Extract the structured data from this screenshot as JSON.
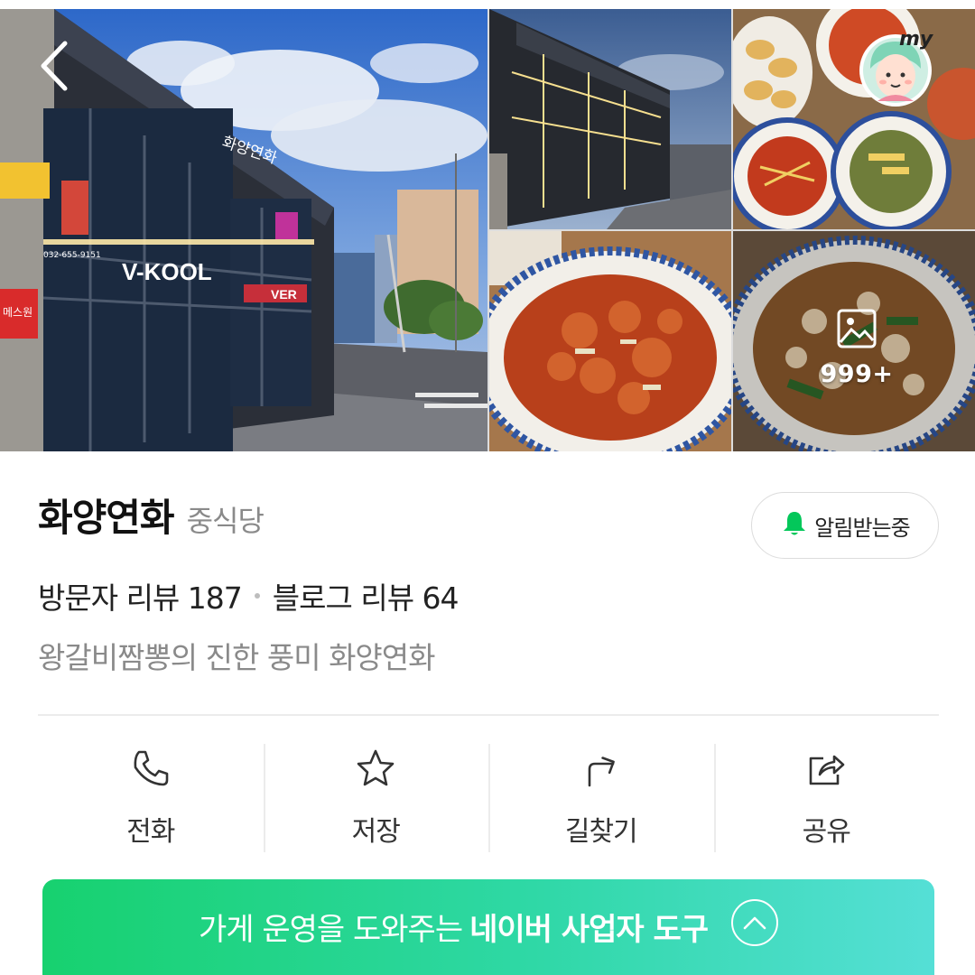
{
  "gallery": {
    "photo_count": "999+",
    "storefront_signs": {
      "main": "V-KOOL",
      "restaurant": "화양연화",
      "phone": "032-655-9151",
      "left_store": "메스원",
      "right_store": "VER"
    }
  },
  "place": {
    "name": "화양연화",
    "category": "중식당",
    "notify_label": "알림받는중",
    "visitor_review": "방문자 리뷰 187",
    "blog_review": "블로그 리뷰 64",
    "description": "왕갈비짬뽕의 진한 풍미 화양연화"
  },
  "actions": [
    {
      "label": "전화",
      "icon": "phone-icon"
    },
    {
      "label": "저장",
      "icon": "star-icon"
    },
    {
      "label": "길찾기",
      "icon": "directions-icon"
    },
    {
      "label": "공유",
      "icon": "share-icon"
    }
  ],
  "banner": {
    "text": "가게 운영을 도와주는",
    "bold_text": "네이버 사업자 도구"
  },
  "colors": {
    "brand_green": "#03c75a",
    "banner_start": "#17d16f",
    "banner_end": "#55dfd6",
    "muted_text": "#8a8a8a"
  }
}
